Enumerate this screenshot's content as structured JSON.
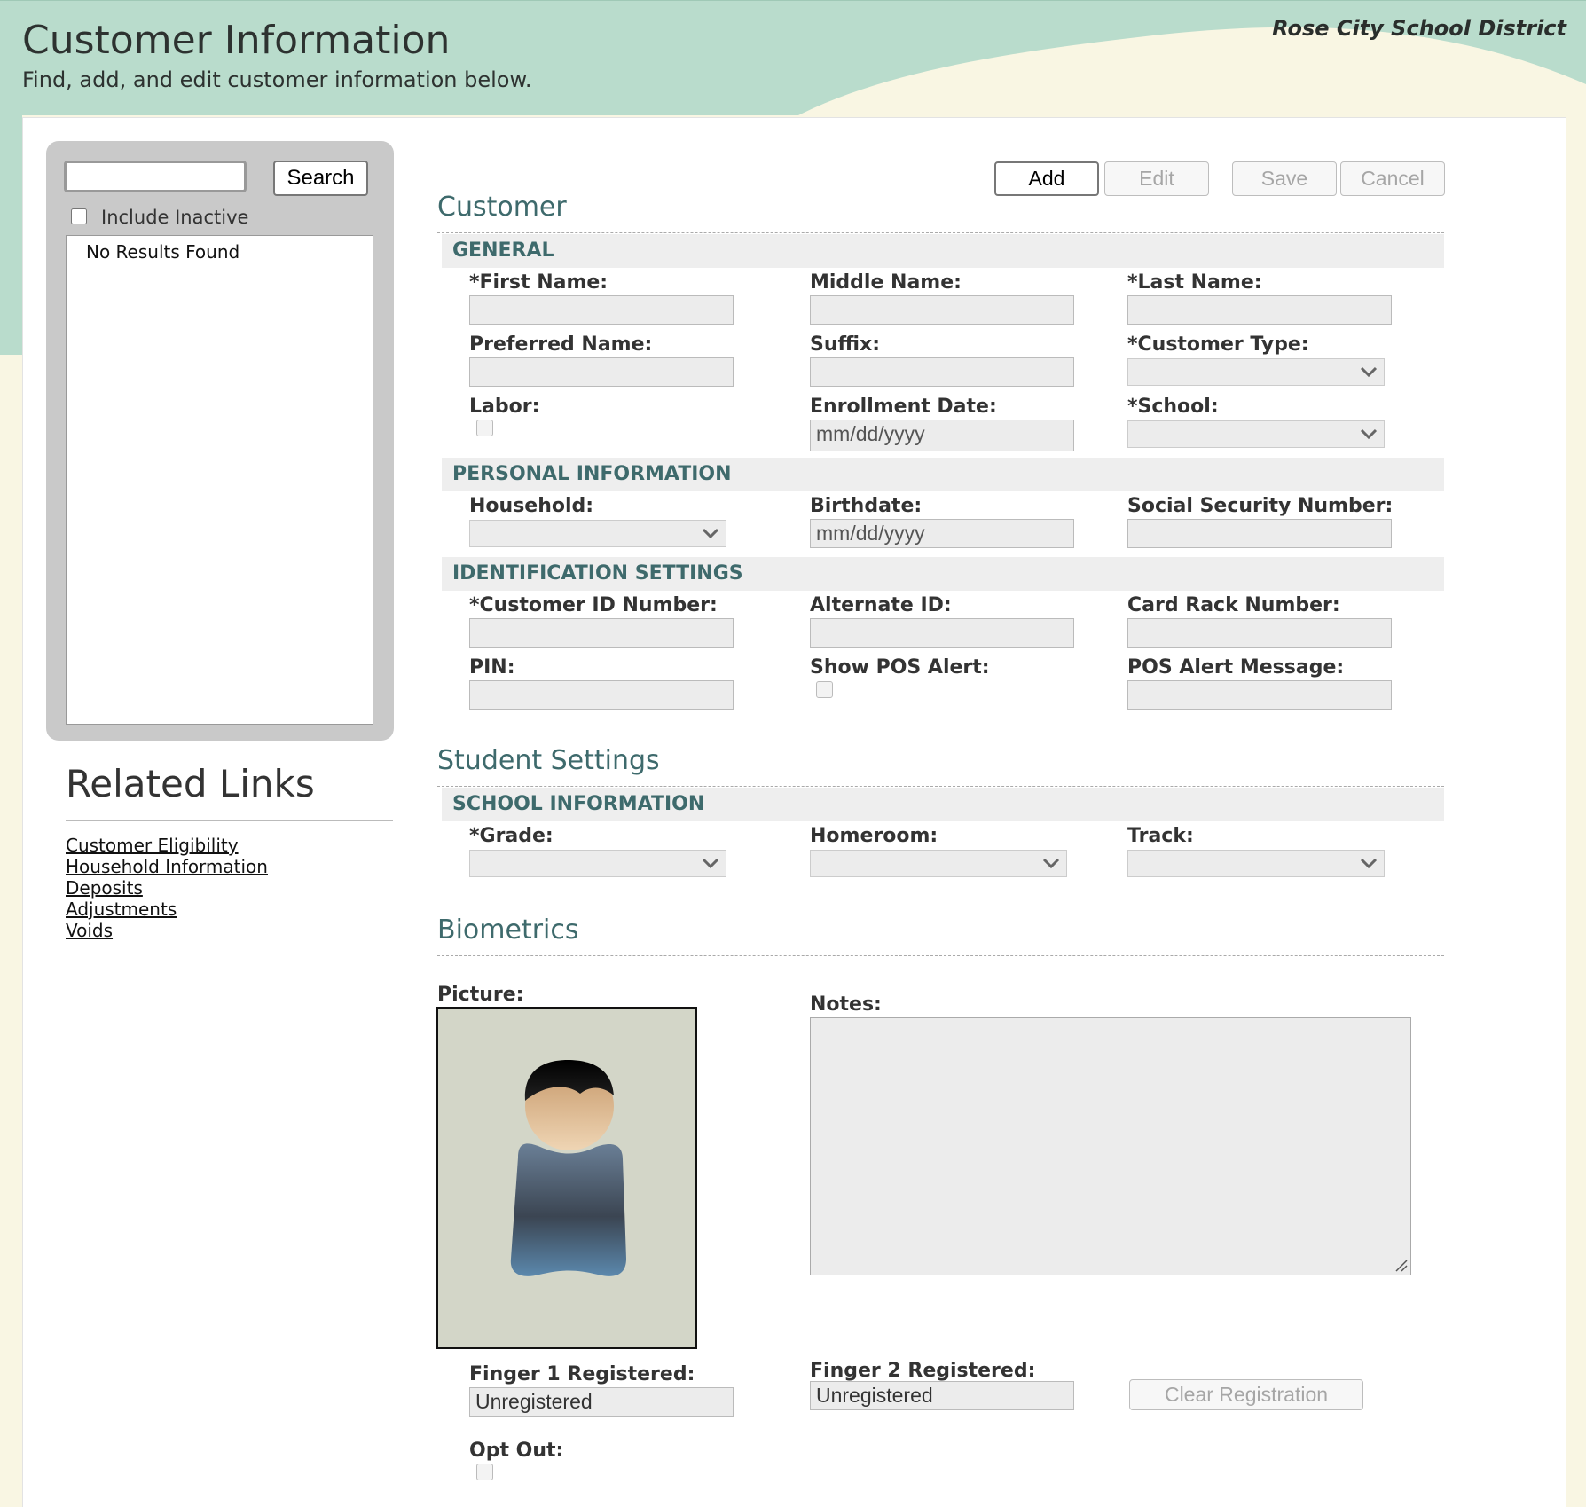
{
  "header": {
    "title": "Customer Information",
    "subtitle": "Find, add, and edit customer information below.",
    "district": "Rose City School District"
  },
  "search": {
    "query": "",
    "button": "Search",
    "include_inactive_label": "Include Inactive",
    "include_inactive_checked": false,
    "no_results": "No Results Found"
  },
  "related": {
    "title": "Related Links",
    "links": [
      "Customer Eligibility",
      "Household Information",
      "Deposits",
      "Adjustments",
      "Voids"
    ]
  },
  "toolbar": {
    "add": "Add",
    "edit": "Edit",
    "save": "Save",
    "cancel": "Cancel"
  },
  "customer": {
    "title": "Customer",
    "general": {
      "heading": "GENERAL",
      "first_name": "*First Name:",
      "middle_name": "Middle Name:",
      "last_name": "*Last Name:",
      "preferred_name": "Preferred Name:",
      "suffix": "Suffix:",
      "customer_type": "*Customer Type:",
      "labor": "Labor:",
      "enrollment_date": "Enrollment Date:",
      "enrollment_placeholder": "mm/dd/yyyy",
      "school": "*School:"
    },
    "personal": {
      "heading": "PERSONAL INFORMATION",
      "household": "Household:",
      "birthdate": "Birthdate:",
      "birthdate_placeholder": "mm/dd/yyyy",
      "ssn": "Social Security Number:"
    },
    "identification": {
      "heading": "IDENTIFICATION SETTINGS",
      "customer_id": "*Customer ID Number:",
      "alternate_id": "Alternate ID:",
      "card_rack": "Card Rack Number:",
      "pin": "PIN:",
      "show_pos_alert": "Show POS Alert:",
      "pos_alert_message": "POS Alert Message:"
    }
  },
  "student": {
    "title": "Student Settings",
    "school_info": {
      "heading": "SCHOOL INFORMATION",
      "grade": "*Grade:",
      "homeroom": "Homeroom:",
      "track": "Track:"
    }
  },
  "biometrics": {
    "title": "Biometrics",
    "picture": "Picture:",
    "notes": "Notes:",
    "finger1_label": "Finger 1 Registered:",
    "finger1_value": "Unregistered",
    "finger2_label": "Finger 2 Registered:",
    "finger2_value": "Unregistered",
    "clear_registration": "Clear Registration",
    "opt_out": "Opt Out:"
  },
  "colors": {
    "header_band": "#b9dccc",
    "page_background": "#f9f6e3",
    "section_heading": "#3e6a6c",
    "subsection_band": "#eeeeee",
    "search_panel": "#c9c9c9"
  }
}
